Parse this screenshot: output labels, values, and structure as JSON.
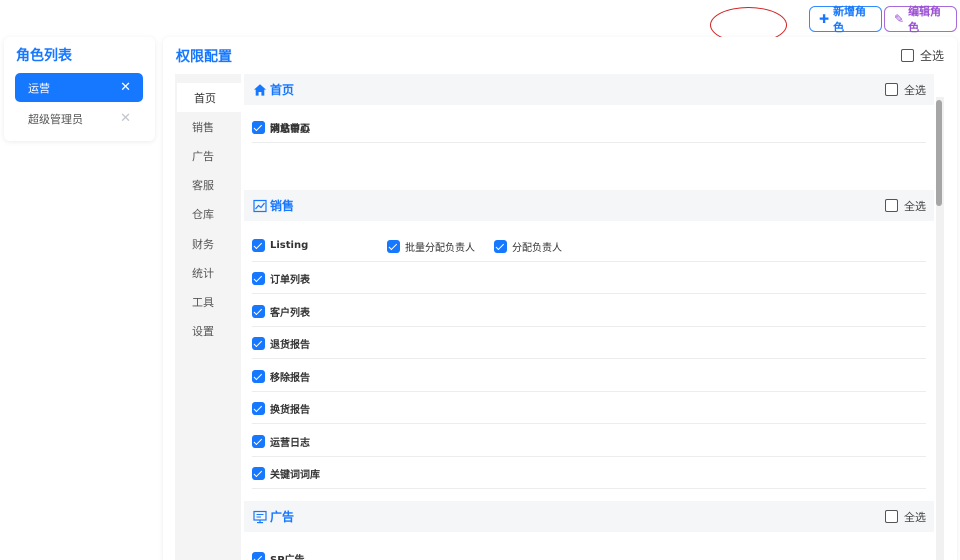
{
  "actions": {
    "add_role": {
      "icon": "plus-icon",
      "label": "新增角色",
      "color": "#1677ff"
    },
    "edit_role": {
      "icon": "pencil-icon",
      "label": "编辑角色",
      "color": "#9b4fd3"
    }
  },
  "roles": {
    "title": "角色列表",
    "items": [
      {
        "label": "运营",
        "active": true
      },
      {
        "label": "超级管理员",
        "active": false
      }
    ]
  },
  "permissions": {
    "title": "权限配置",
    "select_all": "全选",
    "categories": [
      "首页",
      "销售",
      "广告",
      "客服",
      "仓库",
      "财务",
      "统计",
      "工具",
      "设置"
    ],
    "active_category": "首页",
    "sections": [
      {
        "name": "首页",
        "icon": "home-icon",
        "select_all": "全选",
        "rows": [
          [
            {
              "label": "网站首页",
              "checked": true
            }
          ],
          [
            {
              "label": "消息中心",
              "checked": true
            }
          ]
        ]
      },
      {
        "name": "销售",
        "icon": "chart-icon",
        "select_all": "全选",
        "rows": [
          [
            {
              "label": "Listing",
              "checked": true
            },
            {
              "label": "批量分配负责人",
              "checked": true
            },
            {
              "label": "分配负责人",
              "checked": true
            }
          ],
          [
            {
              "label": "订单列表",
              "checked": true
            }
          ],
          [
            {
              "label": "客户列表",
              "checked": true
            }
          ],
          [
            {
              "label": "退货报告",
              "checked": true
            }
          ],
          [
            {
              "label": "移除报告",
              "checked": true
            }
          ],
          [
            {
              "label": "换货报告",
              "checked": true
            }
          ],
          [
            {
              "label": "运营日志",
              "checked": true
            }
          ],
          [
            {
              "label": "关键词词库",
              "checked": true
            }
          ]
        ]
      },
      {
        "name": "广告",
        "icon": "monitor-icon",
        "select_all": "全选",
        "rows": [
          [
            {
              "label": "SP广告",
              "checked": true
            }
          ]
        ]
      }
    ]
  },
  "colors": {
    "accent": "#1677ff",
    "edit": "#9b4fd3",
    "annotation": "#d11f1f"
  }
}
